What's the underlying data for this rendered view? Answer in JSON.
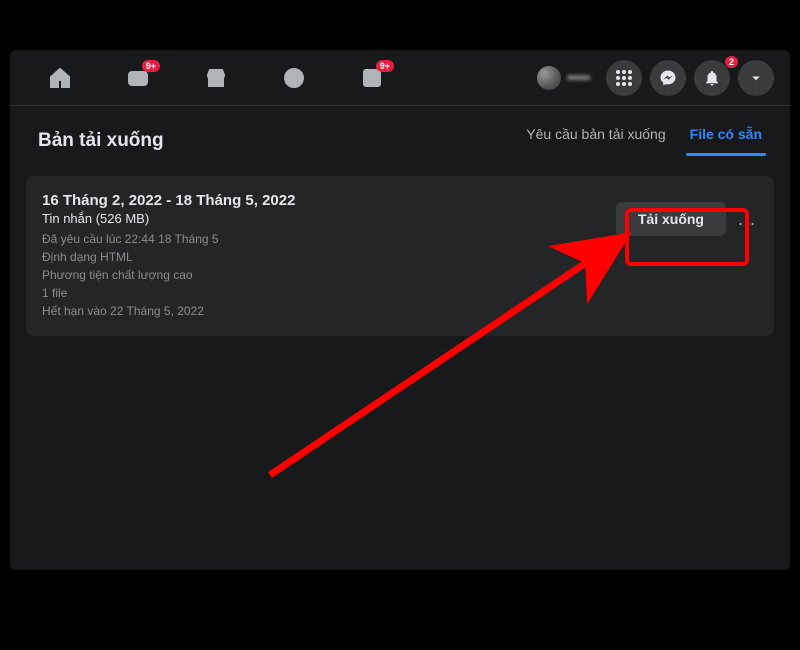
{
  "nav": {
    "badge_video": "9+",
    "badge_gaming": "9+",
    "badge_notif": "2",
    "username": "•••••"
  },
  "page": {
    "title": "Bản tải xuống"
  },
  "tabs": {
    "request": "Yêu cầu bản tải xuống",
    "available": "File có sẵn"
  },
  "item": {
    "date_range": "16 Tháng 2, 2022 - 18 Tháng 5, 2022",
    "subtitle": "Tin nhắn (526 MB)",
    "requested": "Đã yêu cầu lúc 22:44 18 Tháng 5",
    "format": "Định dạng HTML",
    "quality": "Phương tiện chất lượng cao",
    "files": "1 file",
    "expiry": "Hết hạn vào 22 Tháng 5, 2022",
    "download_label": "Tải xuống",
    "more": "..."
  }
}
